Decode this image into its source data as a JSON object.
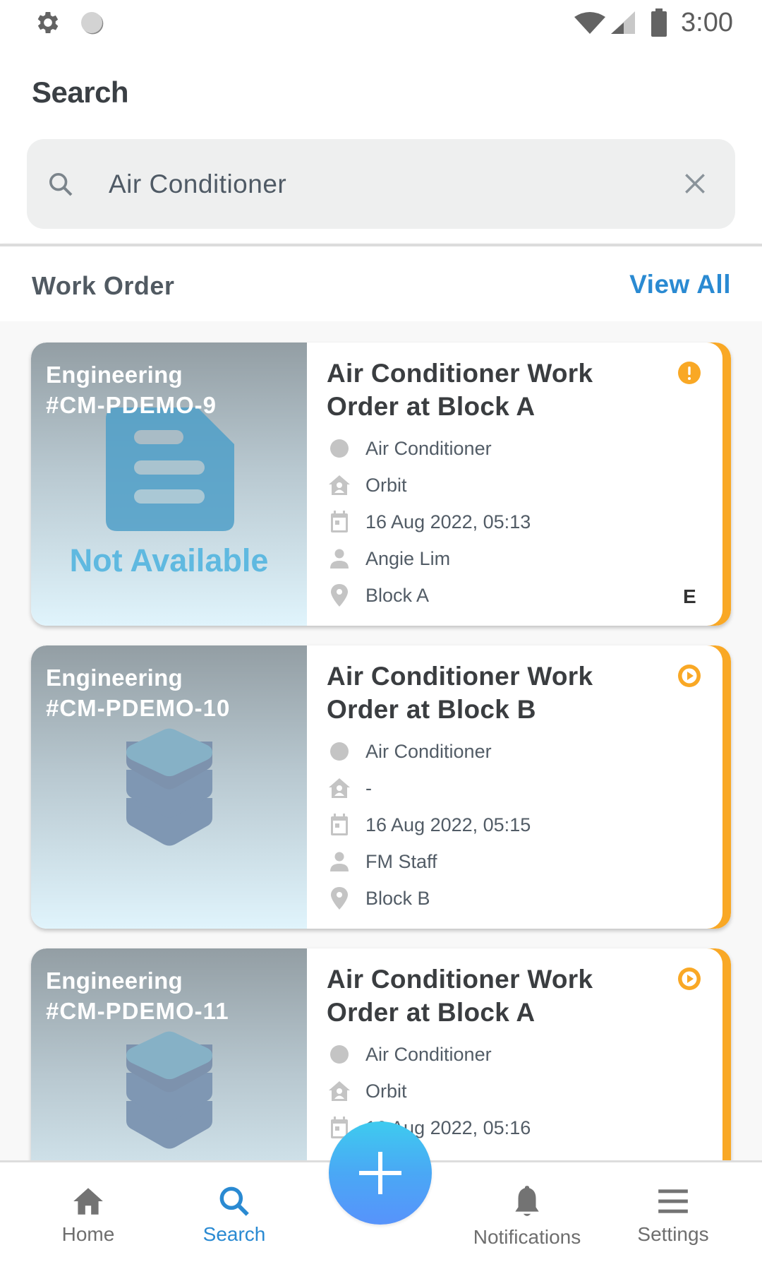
{
  "status_bar": {
    "time": "3:00",
    "left_icons": [
      "gear-icon",
      "sync-icon"
    ],
    "right_icons": [
      "wifi-icon",
      "signal-icon",
      "battery-icon"
    ]
  },
  "header": {
    "title": "Search"
  },
  "search": {
    "value": "Air Conditioner",
    "icon": "search-icon",
    "clear_icon": "close-icon"
  },
  "section": {
    "title": "Work Order",
    "view_all_label": "View All"
  },
  "colors": {
    "accent": "#2a8ad2",
    "card_border": "#f9a825",
    "status_icon": "#f9a825",
    "fab_gradient_top": "#3ecbef",
    "fab_gradient_bottom": "#5793fb"
  },
  "work_orders": [
    {
      "category": "Engineering",
      "id": "#CM-PDEMO-9",
      "thumbnail": "document-icon",
      "thumbnail_label": "Not Available",
      "title": "Air Conditioner Work Order at Block A",
      "status_icon": "alert-icon",
      "asset": "Air Conditioner",
      "site": "Orbit",
      "datetime": "16 Aug 2022, 05:13",
      "assignee": "Angie Lim",
      "location": "Block A",
      "priority": "E"
    },
    {
      "category": "Engineering",
      "id": "#CM-PDEMO-10",
      "thumbnail": "layers-icon",
      "title": "Air Conditioner Work Order at Block B",
      "status_icon": "play-icon",
      "asset": "Air Conditioner",
      "site": "-",
      "datetime": "16 Aug 2022, 05:15",
      "assignee": "FM Staff",
      "location": "Block B"
    },
    {
      "category": "Engineering",
      "id": "#CM-PDEMO-11",
      "thumbnail": "layers-icon",
      "title": "Air Conditioner Work Order at Block A",
      "status_icon": "play-icon",
      "asset": "Air Conditioner",
      "site": "Orbit",
      "datetime": "16 Aug 2022, 05:16"
    }
  ],
  "bottom_nav": {
    "items": [
      {
        "label": "Home",
        "icon": "home-icon",
        "active": false
      },
      {
        "label": "Search",
        "icon": "search-icon",
        "active": true
      },
      {
        "label": "Notifications",
        "icon": "bell-icon",
        "active": false
      },
      {
        "label": "Settings",
        "icon": "menu-icon",
        "active": false
      }
    ],
    "fab_icon": "plus-icon"
  }
}
